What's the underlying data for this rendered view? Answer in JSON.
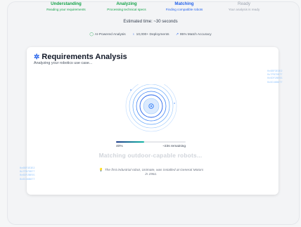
{
  "steps": [
    {
      "title": "Understanding",
      "subtitle": "Reading your requirements",
      "state": "done"
    },
    {
      "title": "Analyzing",
      "subtitle": "Processing technical specs",
      "state": "done"
    },
    {
      "title": "Matching",
      "subtitle": "Finding compatible robots",
      "state": "active"
    },
    {
      "title": "Ready",
      "subtitle": "Your analysis is ready",
      "state": "pending"
    }
  ],
  "estimate": "Estimated time: ~30 seconds",
  "stats": {
    "ai": "AI-Powered Analysis",
    "deployments": "10,000+ Deployments",
    "accuracy": "95% Match Accuracy"
  },
  "card": {
    "title": "Requirements Analysis",
    "subtitle": "Analyzing your robotics use case...",
    "hex_right": [
      "0x6BF3E3E2",
      "0x7FB7DB77",
      "0x6DF2BE55",
      "0x6C46B877"
    ],
    "hex_left": [
      "0x6BF3E3E2",
      "0x7FB7DB77",
      "0x6DF2BE55",
      "0x6C46B877"
    ],
    "progress": {
      "percent_label": "40%",
      "fraction": 0.4,
      "remaining": "~23s remaining"
    },
    "status": "Matching outdoor-capable robots...",
    "fact": "The first industrial robot, Unimate, was installed at General Motors in 1961."
  },
  "colors": {
    "done": "#16a34a",
    "active": "#2563eb",
    "pending": "#9ca3af",
    "accent": "#2563eb"
  },
  "icons": {
    "ai": "target-icon",
    "deployments": "users-icon",
    "accuracy": "trend-icon",
    "title": "network-icon",
    "fact": "lightbulb-icon"
  }
}
